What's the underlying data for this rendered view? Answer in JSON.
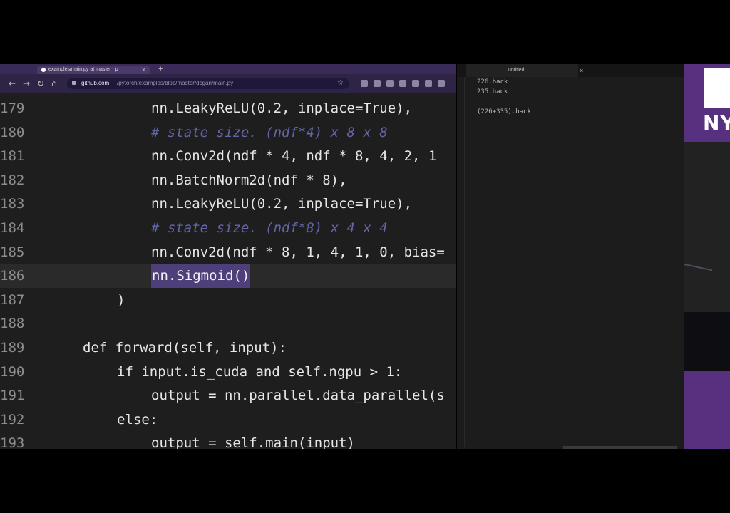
{
  "browser": {
    "tab": {
      "title": "examples/main.py at master · p",
      "close": "×"
    },
    "new_tab": "+",
    "nav": {
      "back": "←",
      "forward": "→",
      "reload": "↻",
      "home": "⌂"
    },
    "url": {
      "host": "github.com",
      "path": "/pytorch/examples/blob/master/dcgan/main.py"
    },
    "bookmark": "☆"
  },
  "code": {
    "lines": [
      {
        "num": "179",
        "indent": 212,
        "text": "nn.LeakyReLU(0.2, inplace=True),",
        "type": "code"
      },
      {
        "num": "180",
        "indent": 212,
        "text": "# state size. (ndf*4) x 8 x 8",
        "type": "comment"
      },
      {
        "num": "181",
        "indent": 212,
        "text": "nn.Conv2d(ndf * 4, ndf * 8, 4, 2, 1",
        "type": "code"
      },
      {
        "num": "182",
        "indent": 212,
        "text": "nn.BatchNorm2d(ndf * 8),",
        "type": "code"
      },
      {
        "num": "183",
        "indent": 212,
        "text": "nn.LeakyReLU(0.2, inplace=True),",
        "type": "code"
      },
      {
        "num": "184",
        "indent": 212,
        "text": "# state size. (ndf*8) x 4 x 4",
        "type": "comment"
      },
      {
        "num": "185",
        "indent": 212,
        "text": "nn.Conv2d(ndf * 8, 1, 4, 1, 0, bias=",
        "type": "code"
      },
      {
        "num": "186",
        "indent": 212,
        "text": "nn.Sigmoid()",
        "type": "selected"
      },
      {
        "num": "187",
        "indent": 164,
        "text": ")",
        "type": "code"
      },
      {
        "num": "188",
        "indent": 212,
        "text": "",
        "type": "code"
      },
      {
        "num": "189",
        "indent": 116,
        "text": "def forward(self, input):",
        "type": "code"
      },
      {
        "num": "190",
        "indent": 164,
        "text": "if input.is_cuda and self.ngpu > 1:",
        "type": "code"
      },
      {
        "num": "191",
        "indent": 212,
        "text": "output = nn.parallel.data_parallel(s",
        "type": "code"
      },
      {
        "num": "192",
        "indent": 164,
        "text": "else:",
        "type": "code"
      },
      {
        "num": "193",
        "indent": 212,
        "text": "output = self.main(input)",
        "type": "code"
      }
    ]
  },
  "text_editor": {
    "title": "untitled",
    "close": "×",
    "lines": [
      "226.back",
      "235.back",
      "",
      "(226+335).back"
    ]
  },
  "right_panel": {
    "logo_text": "NY"
  }
}
